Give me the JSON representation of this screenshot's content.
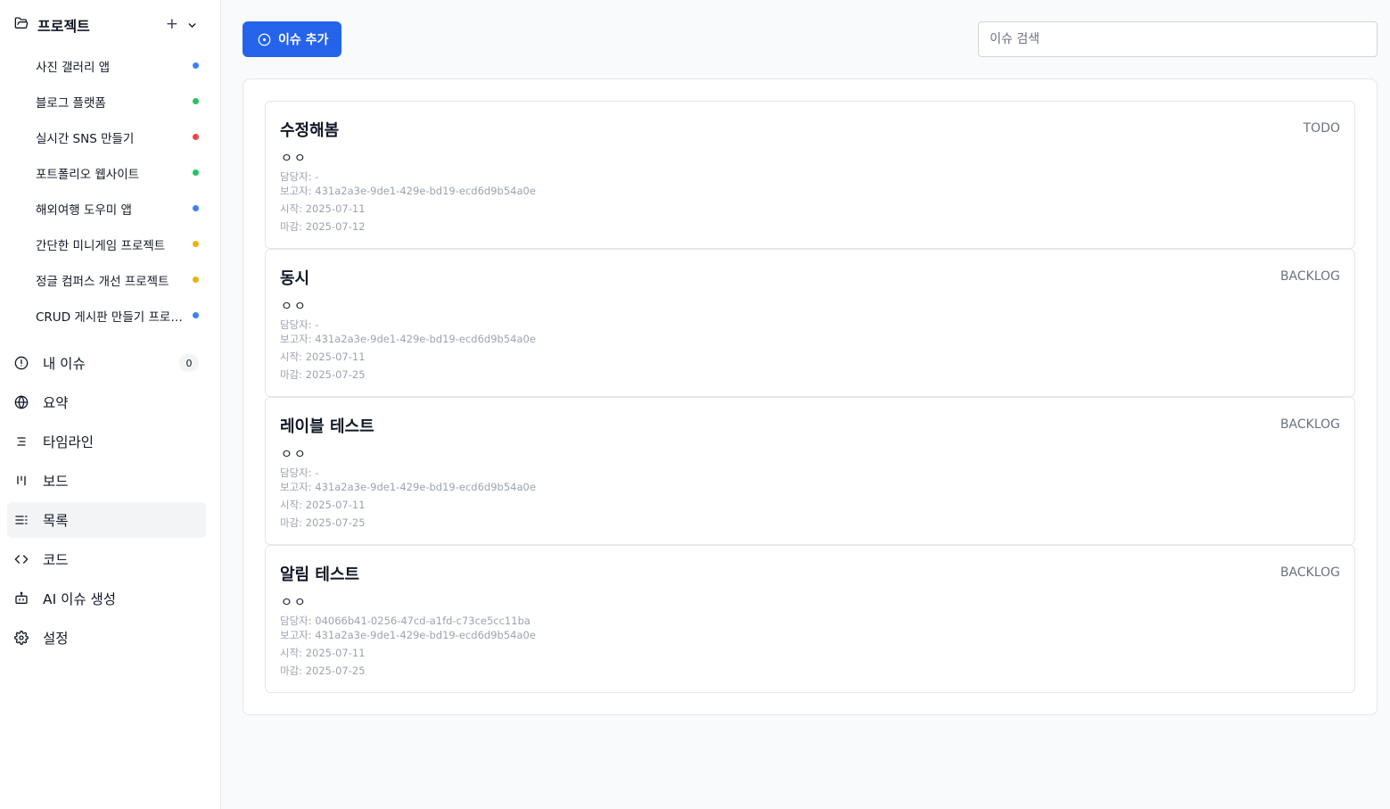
{
  "sidebar": {
    "projects_title": "프로젝트",
    "add_symbol": "+",
    "projects": [
      {
        "name": "사진 갤러리 앱",
        "color": "#3b82f6"
      },
      {
        "name": "블로그 플랫폼",
        "color": "#22c55e"
      },
      {
        "name": "실시간 SNS 만들기",
        "color": "#ef4444"
      },
      {
        "name": "포트폴리오 웹사이트",
        "color": "#22c55e"
      },
      {
        "name": "해외여행 도우미 앱",
        "color": "#3b82f6"
      },
      {
        "name": "간단한 미니게임 프로젝트",
        "color": "#eab308"
      },
      {
        "name": "정글 컴퍼스 개선 프로젝트",
        "color": "#eab308"
      },
      {
        "name": "CRUD 게시판 만들기 프로젝트",
        "color": "#3b82f6"
      }
    ],
    "nav": [
      {
        "label": "내 이슈",
        "icon": "alert-circle-icon",
        "badge": "0"
      },
      {
        "label": "요약",
        "icon": "globe-icon"
      },
      {
        "label": "타임라인",
        "icon": "timeline-icon"
      },
      {
        "label": "보드",
        "icon": "board-icon"
      },
      {
        "label": "목록",
        "icon": "list-icon",
        "active": true
      },
      {
        "label": "코드",
        "icon": "code-icon"
      },
      {
        "label": "AI 이슈 생성",
        "icon": "bot-icon"
      },
      {
        "label": "설정",
        "icon": "gear-icon"
      }
    ]
  },
  "toolbar": {
    "add_issue_label": "이슈 추가",
    "search_placeholder": "이슈 검색"
  },
  "colors": {
    "accent": "#2563eb"
  },
  "issues": [
    {
      "title": "수정해봄",
      "status": "TODO",
      "description": "ㅇㅇ",
      "assignee": "담당자: -",
      "reporter": "보고자: 431a2a3e-9de1-429e-bd19-ecd6d9b54a0e",
      "start": "시작: 2025-07-11",
      "due": "마감: 2025-07-12"
    },
    {
      "title": "동시",
      "status": "BACKLOG",
      "description": "ㅇㅇ",
      "assignee": "담당자: -",
      "reporter": "보고자: 431a2a3e-9de1-429e-bd19-ecd6d9b54a0e",
      "start": "시작: 2025-07-11",
      "due": "마감: 2025-07-25"
    },
    {
      "title": "레이블 테스트",
      "status": "BACKLOG",
      "description": "ㅇㅇ",
      "assignee": "담당자: -",
      "reporter": "보고자: 431a2a3e-9de1-429e-bd19-ecd6d9b54a0e",
      "start": "시작: 2025-07-11",
      "due": "마감: 2025-07-25"
    },
    {
      "title": "알림 테스트",
      "status": "BACKLOG",
      "description": "ㅇㅇ",
      "assignee": "담당자: 04066b41-0256-47cd-a1fd-c73ce5cc11ba",
      "reporter": "보고자: 431a2a3e-9de1-429e-bd19-ecd6d9b54a0e",
      "start": "시작: 2025-07-11",
      "due": "마감: 2025-07-25"
    }
  ]
}
